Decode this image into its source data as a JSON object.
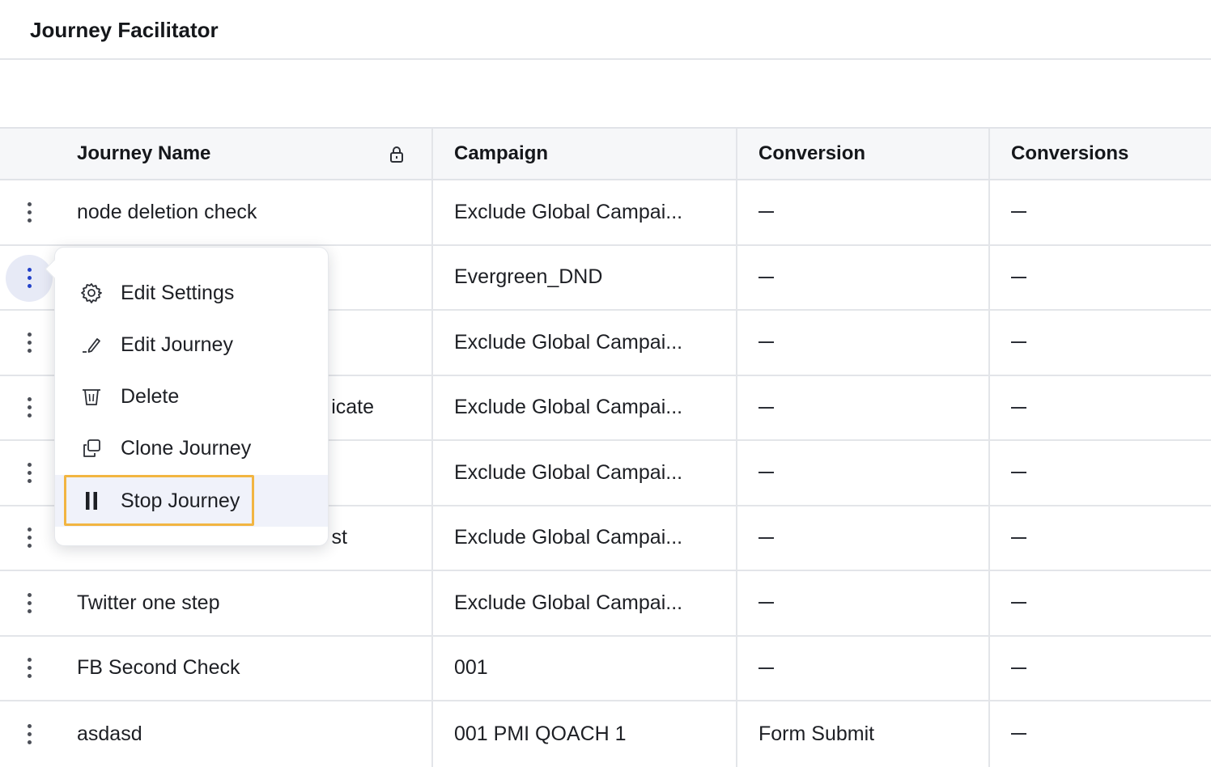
{
  "header": {
    "title": "Journey Facilitator"
  },
  "table": {
    "columns": [
      "Journey Name",
      "Campaign",
      "Conversion",
      "Conversions"
    ],
    "rows": [
      {
        "name": "node deletion check",
        "campaign": "Exclude Global Campai...",
        "conversion": "—",
        "conversions": "—"
      },
      {
        "name": "",
        "campaign": "Evergreen_DND",
        "conversion": "—",
        "conversions": "—"
      },
      {
        "name": "",
        "campaign": "Exclude Global Campai...",
        "conversion": "—",
        "conversions": "—"
      },
      {
        "name": "icate",
        "campaign": "Exclude Global Campai...",
        "conversion": "—",
        "conversions": "—"
      },
      {
        "name": "",
        "campaign": "Exclude Global Campai...",
        "conversion": "—",
        "conversions": "—"
      },
      {
        "name": "st",
        "campaign": "Exclude Global Campai...",
        "conversion": "—",
        "conversions": "—"
      },
      {
        "name": "Twitter one step",
        "campaign": "Exclude Global Campai...",
        "conversion": "—",
        "conversions": "—"
      },
      {
        "name": "FB Second Check",
        "campaign": "001",
        "conversion": "—",
        "conversions": "—"
      },
      {
        "name": "asdasd",
        "campaign": "001 PMI QOACH 1",
        "conversion": "Form Submit",
        "conversions": "—"
      }
    ]
  },
  "context_menu": {
    "items": [
      {
        "label": "Edit Settings",
        "icon": "gear-icon"
      },
      {
        "label": "Edit Journey",
        "icon": "pencil-icon"
      },
      {
        "label": "Delete",
        "icon": "trash-icon"
      },
      {
        "label": "Clone Journey",
        "icon": "clone-icon"
      },
      {
        "label": "Stop Journey",
        "icon": "pause-icon",
        "highlighted": true
      }
    ]
  },
  "colors": {
    "accent": "#2342c9",
    "highlight_border": "#f2b541",
    "header_bg": "#f6f7f9"
  }
}
